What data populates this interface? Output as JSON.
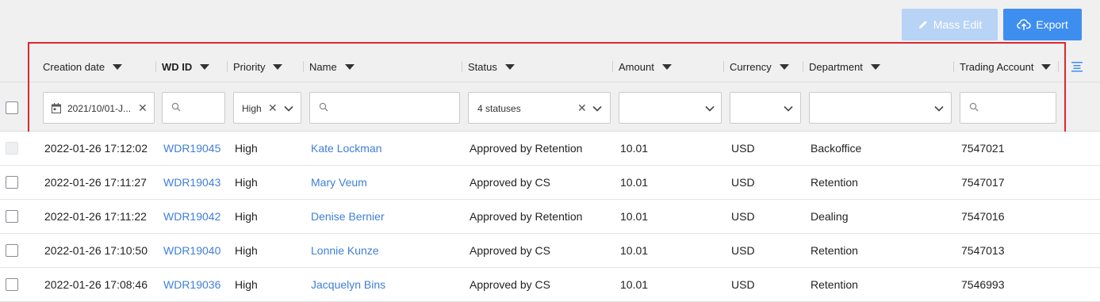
{
  "toolbar": {
    "mass_edit_label": "Mass Edit",
    "export_label": "Export"
  },
  "columns": [
    {
      "label": "Creation date"
    },
    {
      "label": "WD ID"
    },
    {
      "label": "Priority"
    },
    {
      "label": "Name"
    },
    {
      "label": "Status"
    },
    {
      "label": "Amount"
    },
    {
      "label": "Currency"
    },
    {
      "label": "Department"
    },
    {
      "label": "Trading Account"
    }
  ],
  "filters": {
    "creation_date": "2021/10/01-J...",
    "priority": "High",
    "status": "4 statuses",
    "wd_id": "",
    "name": "",
    "amount": "",
    "currency": "",
    "department": "",
    "trading_account": ""
  },
  "rows": [
    {
      "date": "2022-01-26 17:12:02",
      "wd_id": "WDR19045",
      "priority": "High",
      "name": "Kate Lockman",
      "status": "Approved by Retention",
      "amount": "10.01",
      "currency": "USD",
      "department": "Backoffice",
      "account": "7547021"
    },
    {
      "date": "2022-01-26 17:11:27",
      "wd_id": "WDR19043",
      "priority": "High",
      "name": "Mary Veum",
      "status": "Approved by CS",
      "amount": "10.01",
      "currency": "USD",
      "department": "Retention",
      "account": "7547017"
    },
    {
      "date": "2022-01-26 17:11:22",
      "wd_id": "WDR19042",
      "priority": "High",
      "name": "Denise Bernier",
      "status": "Approved by Retention",
      "amount": "10.01",
      "currency": "USD",
      "department": "Dealing",
      "account": "7547016"
    },
    {
      "date": "2022-01-26 17:10:50",
      "wd_id": "WDR19040",
      "priority": "High",
      "name": "Lonnie Kunze",
      "status": "Approved by CS",
      "amount": "10.01",
      "currency": "USD",
      "department": "Retention",
      "account": "7547013"
    },
    {
      "date": "2022-01-26 17:08:46",
      "wd_id": "WDR19036",
      "priority": "High",
      "name": "Jacquelyn Bins",
      "status": "Approved by CS",
      "amount": "10.01",
      "currency": "USD",
      "department": "Retention",
      "account": "7546993"
    }
  ],
  "icons": {
    "mass_edit": "pencil-icon",
    "export": "cloud-upload-icon",
    "column_settings": "columns-settings-icon",
    "date": "calendar-icon",
    "search": "search-icon",
    "clear": "close-icon",
    "dropdown": "chevron-down-icon"
  },
  "colors": {
    "accent": "#3e8ef0",
    "accent_disabled": "#b7d3f6",
    "link": "#3f7fd8",
    "highlight_border": "#e0262c",
    "header_bg": "#f0f0f1"
  }
}
